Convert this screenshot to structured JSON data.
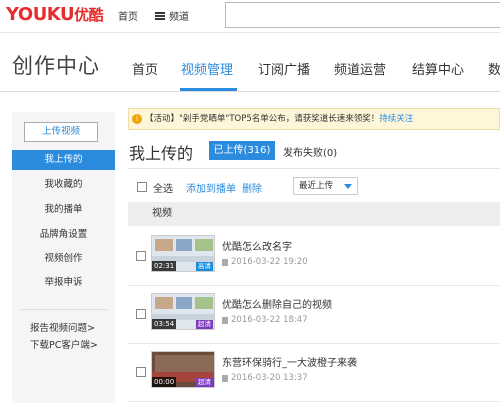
{
  "topbar": {
    "logo_latin": "YOUKU",
    "logo_zh": "优酷",
    "home": "首页",
    "channel": "频道",
    "search_placeholder": ""
  },
  "header": {
    "brand": "创作中心",
    "tabs": [
      {
        "label": "首页",
        "active": false
      },
      {
        "label": "视频管理",
        "active": true
      },
      {
        "label": "订阅广播",
        "active": false
      },
      {
        "label": "频道运营",
        "active": false
      },
      {
        "label": "结算中心",
        "active": false
      },
      {
        "label": "数",
        "active": false
      }
    ]
  },
  "sidebar": {
    "upload_button": "上传视频",
    "items": [
      {
        "label": "我上传的",
        "active": true
      },
      {
        "label": "我收藏的",
        "active": false
      },
      {
        "label": "我的播单",
        "active": false
      },
      {
        "label": "品牌角设置",
        "active": false
      },
      {
        "label": "视频创作",
        "active": false
      },
      {
        "label": "举报申诉",
        "active": false
      }
    ],
    "links": [
      "报告视频问题>",
      "下载PC客户端>"
    ]
  },
  "notice": {
    "text": "【活动】\"剁手党晒单\"TOP5名单公布，请获奖道长速来领奖！",
    "link": "持续关注"
  },
  "content": {
    "title": "我上传的",
    "tab_uploaded": "已上传(316)",
    "tab_failed": "发布失败(0)"
  },
  "toolbar": {
    "select_all": "全选",
    "add_to_playlist": "添加到播单",
    "delete": "删除",
    "sort_value": "最近上传"
  },
  "list": {
    "column_header": "视频",
    "rows": [
      {
        "title": "优酷怎么改名字",
        "date": "2016-03-22 19:20",
        "duration": "02:31",
        "quality": "高清"
      },
      {
        "title": "优酷怎么删除自己的视频",
        "date": "2016-03-22 18:47",
        "duration": "03:54",
        "quality": "超清"
      },
      {
        "title": "东营环保骑行_一大波橙子来袭",
        "date": "2016-03-20 13:37",
        "duration": "00:00",
        "quality": "超清"
      }
    ]
  },
  "colors": {
    "accent": "#2b8bde",
    "logo": "#e62d2d",
    "notice_bg": "#fdf6d9"
  }
}
